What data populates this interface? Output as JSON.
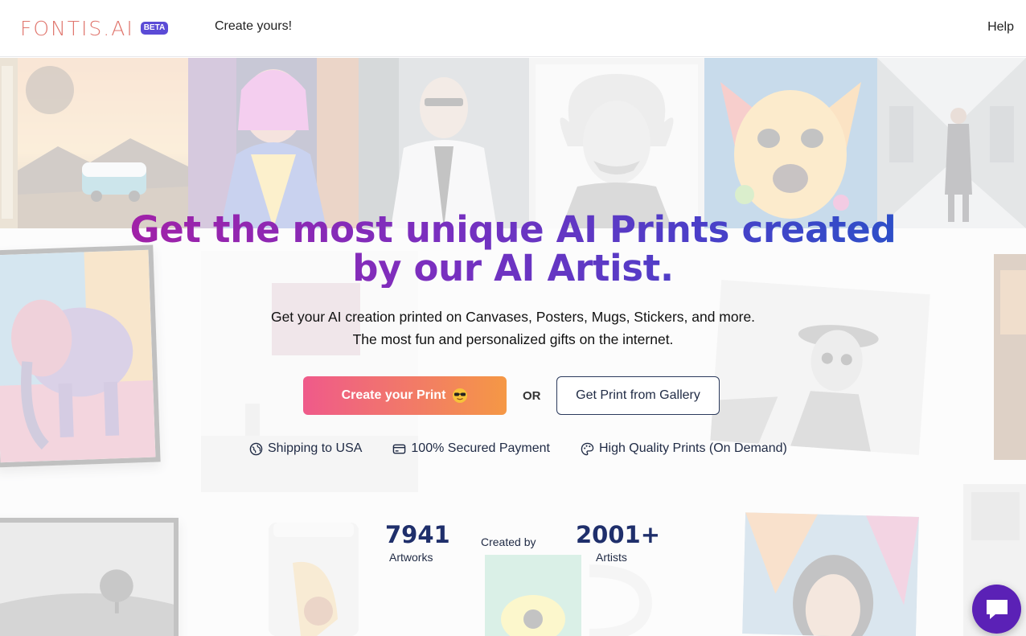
{
  "header": {
    "logo_text": "FONTIS.AI",
    "beta_badge": "BETA",
    "nav_create": "Create yours!",
    "nav_help": "Help"
  },
  "hero": {
    "headline_line1": "Get the most unique AI Prints created",
    "headline_line2": "by our AI Artist.",
    "subtitle": "Get your AI creation printed on Canvases, Posters, Mugs, Stickers, and more. The most fun and personalized gifts on the internet.",
    "primary_cta": "Create your Print",
    "or_text": "OR",
    "secondary_cta": "Get Print from Gallery"
  },
  "features": [
    {
      "label": "Shipping to USA",
      "icon": "globe-icon"
    },
    {
      "label": "100% Secured Payment",
      "icon": "credit-card-icon"
    },
    {
      "label": "High Quality Prints (On Demand)",
      "icon": "palette-icon"
    }
  ],
  "stats": {
    "artworks_value": "7941",
    "artworks_label": "Artworks",
    "created_by": "Created by",
    "artists_value": "2001+",
    "artists_label": "Artists"
  },
  "colors": {
    "brand_logo": "#e0766e",
    "beta_badge": "#5b4bd6",
    "headline_gradient_start": "#a021a8",
    "headline_gradient_end": "#2e4fc8",
    "cta_gradient_start": "#ef5a8a",
    "cta_gradient_end": "#f59845",
    "stat_number": "#1f2f6b",
    "chat_button": "#5b21b6"
  }
}
